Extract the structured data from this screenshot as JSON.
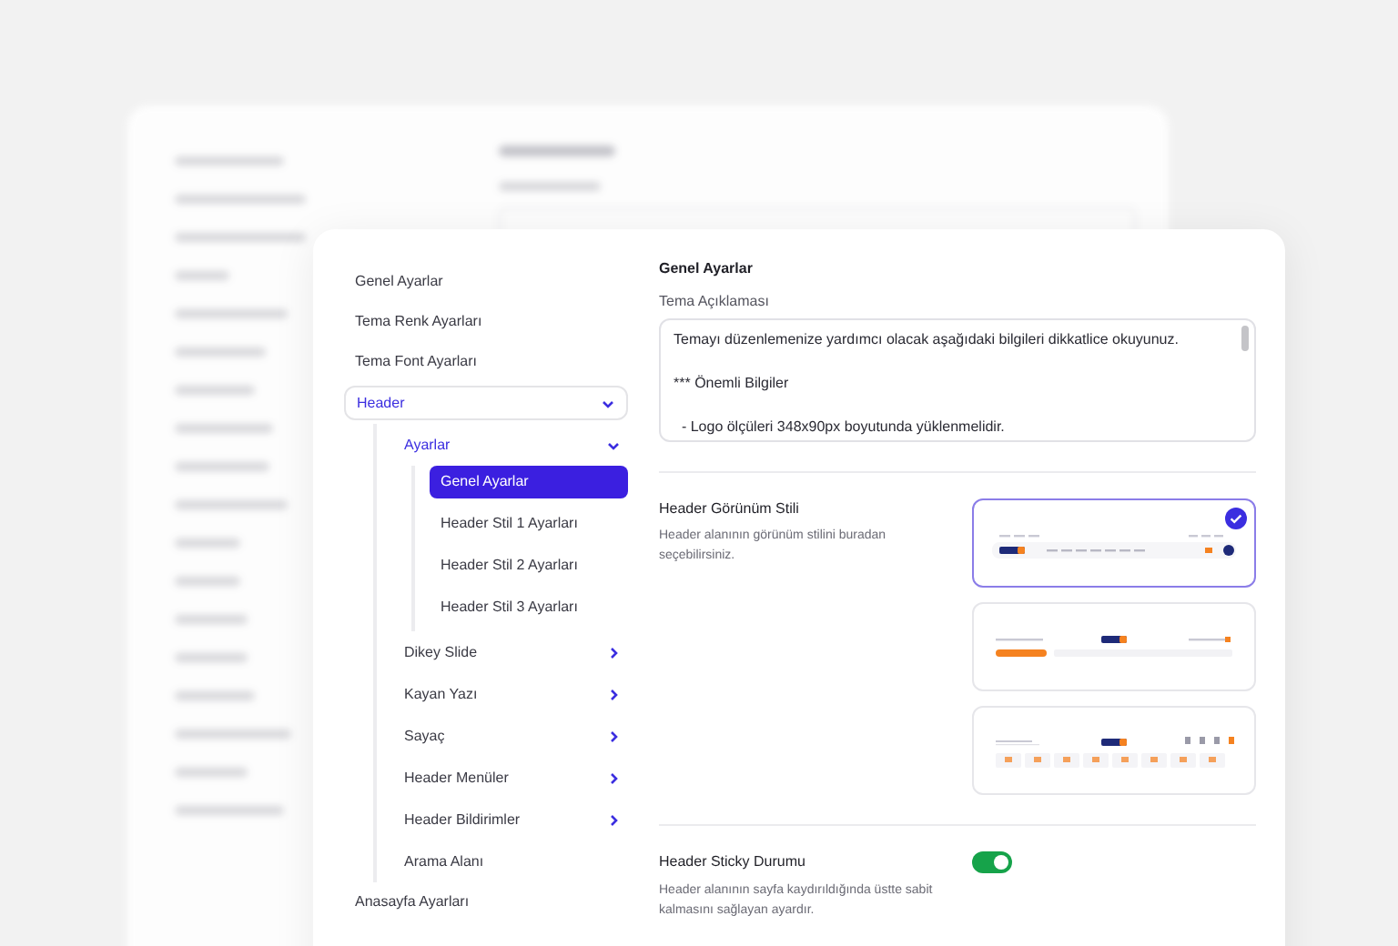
{
  "sidebar": {
    "items": [
      {
        "label": "Genel Ayarlar"
      },
      {
        "label": "Tema Renk Ayarları"
      },
      {
        "label": "Tema Font Ayarları"
      },
      {
        "label": "Header",
        "expanded": true,
        "children": [
          {
            "label": "Ayarlar",
            "expanded": true,
            "children": [
              {
                "label": "Genel Ayarlar",
                "selected": true
              },
              {
                "label": "Header Stil 1 Ayarları",
                "selected": false
              },
              {
                "label": "Header Stil 2 Ayarları",
                "selected": false
              },
              {
                "label": "Header Stil 3 Ayarları",
                "selected": false
              }
            ]
          },
          {
            "label": "Dikey Slide",
            "expanded": false
          },
          {
            "label": "Kayan Yazı",
            "expanded": false
          },
          {
            "label": "Sayaç",
            "expanded": false
          },
          {
            "label": "Header Menüler",
            "expanded": false
          },
          {
            "label": "Header Bildirimler",
            "expanded": false
          },
          {
            "label": "Arama Alanı"
          }
        ]
      },
      {
        "label": "Anasayfa Ayarları"
      }
    ]
  },
  "content": {
    "title": "Genel Ayarlar",
    "description_field": {
      "label": "Tema Açıklaması",
      "value": "Temayı düzenlemenize yardımcı olacak aşağıdaki bilgileri dikkatlice okuyunuz.\n\n*** Önemli Bilgiler\n\n  - Logo ölçüleri 348x90px boyutunda yüklenmelidir."
    },
    "header_style": {
      "title": "Header Görünüm Stili",
      "hint": "Header alanının görünüm stilini buradan seçebilirsiniz.",
      "options": [
        {
          "kind": "inline",
          "selected": true
        },
        {
          "kind": "centered",
          "selected": false
        },
        {
          "kind": "icons",
          "selected": false
        }
      ]
    },
    "sticky": {
      "title": "Header Sticky Durumu",
      "hint": "Header alanının sayfa kaydırıldığında üstte sabit kalmasını sağlayan ayardır.",
      "on": true
    }
  }
}
